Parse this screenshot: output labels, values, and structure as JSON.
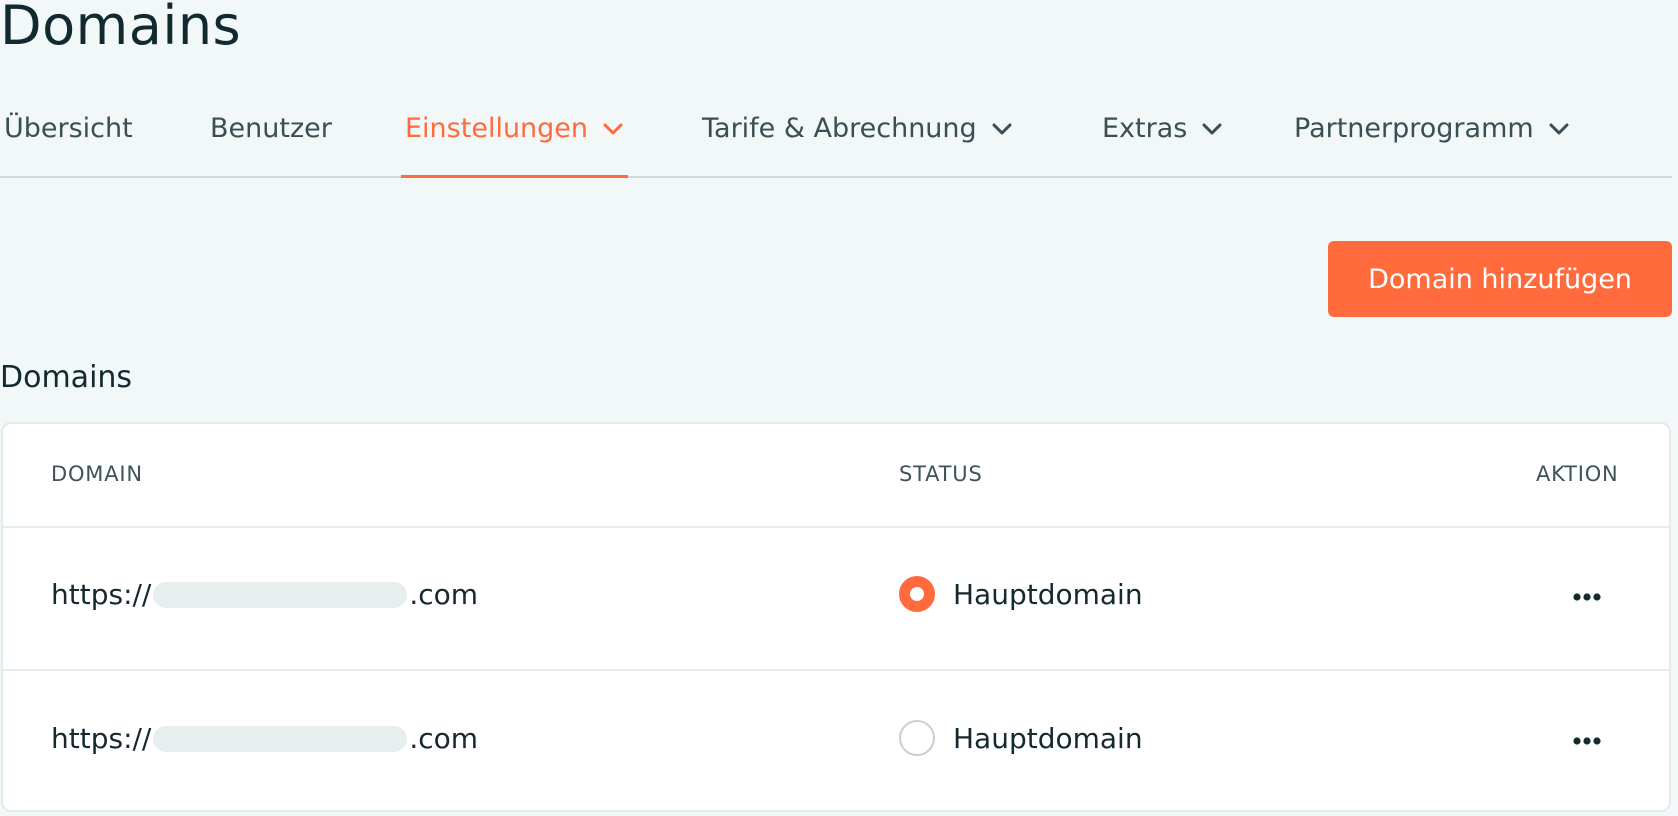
{
  "page": {
    "title": "Domains"
  },
  "tabs": [
    {
      "label": "Übersicht",
      "active": false,
      "has_dropdown": false
    },
    {
      "label": "Benutzer",
      "active": false,
      "has_dropdown": false
    },
    {
      "label": "Einstellungen",
      "active": true,
      "has_dropdown": true
    },
    {
      "label": "Tarife & Abrechnung",
      "active": false,
      "has_dropdown": true
    },
    {
      "label": "Extras",
      "active": false,
      "has_dropdown": true
    },
    {
      "label": "Partnerprogramm",
      "active": false,
      "has_dropdown": true
    }
  ],
  "toolbar": {
    "add_domain_label": "Domain hinzufügen"
  },
  "section": {
    "heading": "Domains"
  },
  "table": {
    "columns": [
      "DOMAIN",
      "STATUS",
      "AKTION"
    ],
    "rows": [
      {
        "domain_prefix": "https://",
        "domain_suffix": ".com",
        "status": "Hauptdomain",
        "is_primary": true,
        "action_icon": "more-horizontal-icon"
      },
      {
        "domain_prefix": "https://",
        "domain_suffix": ".com",
        "status": "Hauptdomain",
        "is_primary": false,
        "action_icon": "more-horizontal-icon"
      }
    ]
  },
  "colors": {
    "accent": "#ff6b3d",
    "background": "#f2f7f7",
    "text": "#16292e",
    "muted_text": "#3a4f55",
    "border": "#cfd9da"
  }
}
